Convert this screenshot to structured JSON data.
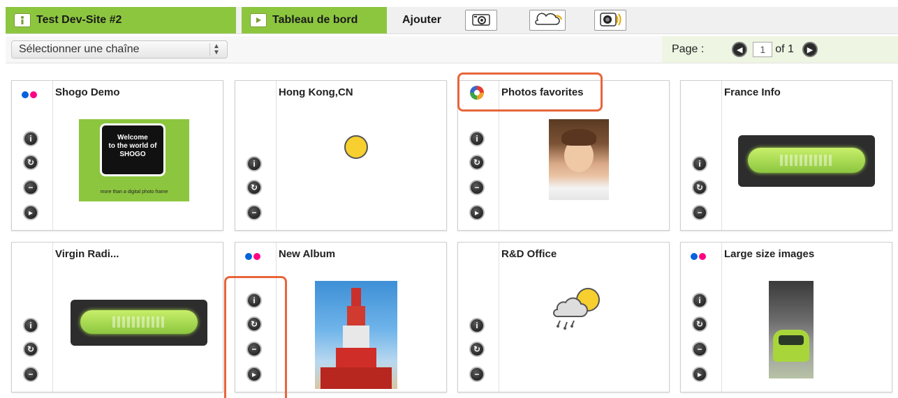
{
  "topnav": {
    "site_label": "Test Dev-Site #2",
    "dashboard_label": "Tableau de bord",
    "add_label": "Ajouter",
    "add_buttons": [
      "camera-icon",
      "cloud-icon",
      "radio-icon"
    ]
  },
  "subbar": {
    "channel_select_value": "Sélectionner une chaîne",
    "page_label": "Page :",
    "page_current": "1",
    "page_of": "of 1"
  },
  "cards": [
    {
      "title": "Shogo Demo",
      "source": "flickr",
      "thumb": "shogo",
      "thumb_text": [
        "Welcome",
        "to the world of",
        "SHOGO",
        "more than a digital photo frame"
      ]
    },
    {
      "title": "Hong Kong,CN",
      "source": "none",
      "thumb": "sun"
    },
    {
      "title": "Photos favorites",
      "source": "picasa",
      "thumb": "child-photo"
    },
    {
      "title": "France Info",
      "source": "none",
      "thumb": "radio-display"
    },
    {
      "title": "Virgin Radi...",
      "source": "none",
      "thumb": "radio-display"
    },
    {
      "title": "New Album",
      "source": "flickr",
      "thumb": "human-tower-photo"
    },
    {
      "title": "R&D Office",
      "source": "none",
      "thumb": "weather-rain-sun"
    },
    {
      "title": "Large size images",
      "source": "flickr",
      "thumb": "car-photo"
    }
  ],
  "colors": {
    "accent_green": "#8cc63f",
    "highlight_orange": "#e8653a",
    "flickr_blue": "#0063dc",
    "flickr_pink": "#ff0084"
  }
}
